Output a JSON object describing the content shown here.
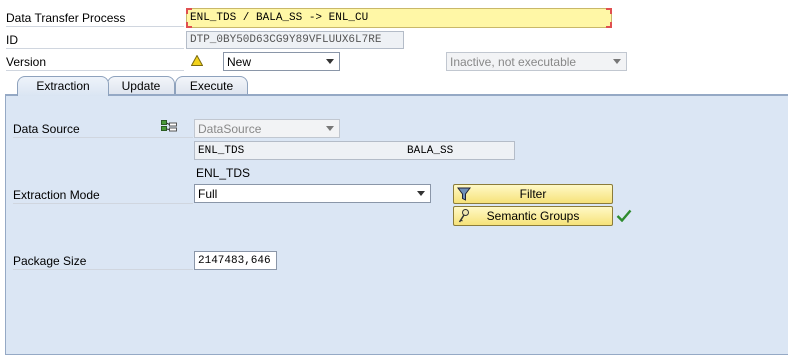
{
  "header": {
    "dtp_label": "Data Transfer Process",
    "dtp_value": "ENL_TDS / BALA_SS -> ENL_CU",
    "id_label": "ID",
    "id_value": "DTP_0BY50D63CG9Y89VFLUUX6L7RE",
    "version_label": "Version",
    "version_value": "New",
    "status_value": "Inactive, not executable"
  },
  "tabs": [
    "Extraction",
    "Update",
    "Execute"
  ],
  "extraction": {
    "data_source_label": "Data Source",
    "data_source_type": "DataSource",
    "source_name": "ENL_TDS",
    "source_system": "BALA_SS",
    "source_description": "ENL_TDS",
    "extraction_mode_label": "Extraction Mode",
    "extraction_mode_value": "Full",
    "package_size_label": "Package Size",
    "package_size_value": "2147483,646"
  },
  "buttons": {
    "filter_label": "Filter",
    "semantic_groups_label": "Semantic Groups"
  },
  "colors": {
    "panel_bg": "#dbe6f4",
    "required_field_bg": "#fff7a6",
    "button_bg": "#f6e27a",
    "ok_check": "#2e8b2e"
  }
}
